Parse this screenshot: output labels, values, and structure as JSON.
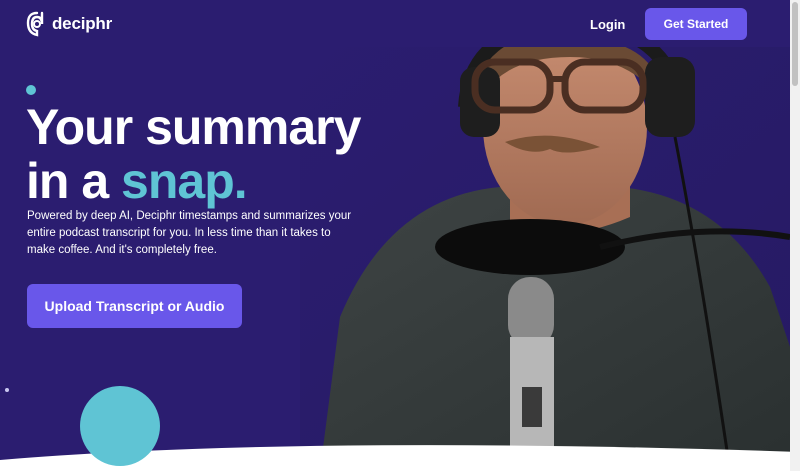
{
  "nav": {
    "brand": "deciphr",
    "login": "Login",
    "get_started": "Get Started"
  },
  "hero": {
    "headline_line1": "Your summary",
    "headline_line2_prefix": "in a ",
    "headline_accent": "snap.",
    "description": "Powered by deep AI, Deciphr timestamps and summarizes your entire podcast transcript for you. In less time than it takes to make coffee. And it's completely free.",
    "upload_button": "Upload Transcript or Audio"
  },
  "colors": {
    "background": "#2b1d70",
    "accent_teal": "#5fc4d4",
    "button_purple": "#6957ea",
    "stripes": "#8f86f0"
  },
  "icons": {
    "logo": "deciphr-logo-icon"
  }
}
